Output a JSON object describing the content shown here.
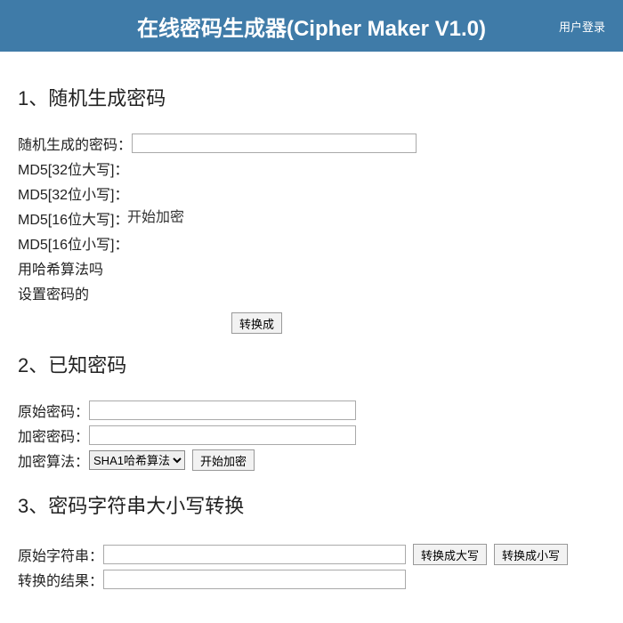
{
  "header": {
    "title": "在线密码生成器(Cipher Maker V1.0)",
    "login": "用户登录"
  },
  "section1": {
    "title": "1、随机生成密码",
    "label_generated": "随机生成的密码：",
    "label_md5_32a": "MD5[32位大写]：",
    "label_md5_32b": "MD5[32位小写]：",
    "label_md5_16a": "MD5[16位大写]：",
    "label_md5_16b": "MD5[16位小写]：",
    "label_hash": "用哈希算法吗",
    "label_setpwd": "设置密码的",
    "btn_encrypt_float": "开始加密",
    "btn_convert": "转换成"
  },
  "section2": {
    "title": "2、已知密码",
    "label_original": "原始密码：",
    "label_encrypted": "加密密码：",
    "label_algorithm": "加密算法：",
    "select_option": "SHA1哈希算法",
    "btn_encrypt": "开始加密"
  },
  "section3": {
    "title": "3、密码字符串大小写转换",
    "label_original": "原始字符串：",
    "label_result": "转换的结果：",
    "btn_upper": "转换成大写",
    "btn_lower": "转换成小写"
  }
}
